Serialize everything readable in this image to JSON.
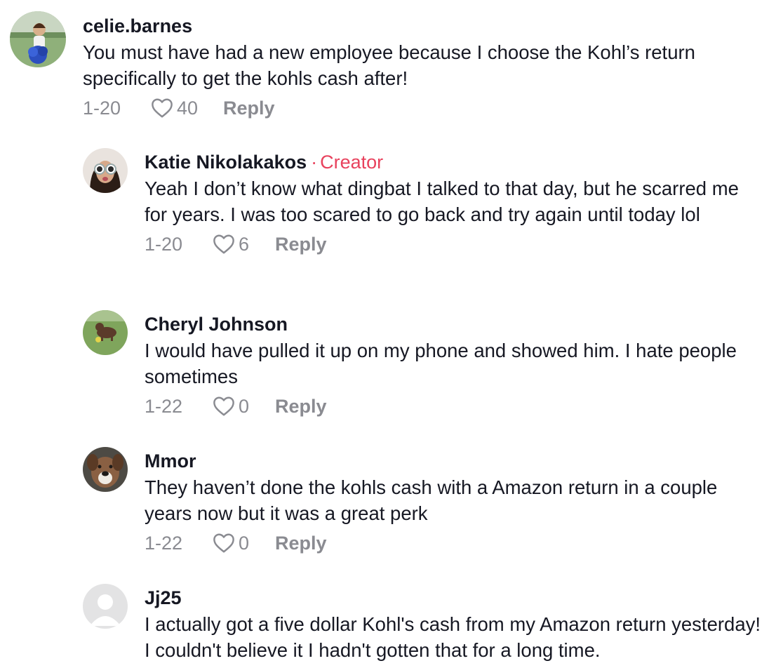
{
  "comments": [
    {
      "username": "celie.barnes",
      "text": "You must have had a new employee because I choose the Kohl’s return specifically to get the kohls cash after!",
      "date": "1-20",
      "likes": "40",
      "reply": "Reply"
    },
    {
      "username": "Katie Nikolakakos",
      "dot": "·",
      "badge": "Creator",
      "text": "Yeah I don’t know what dingbat I talked to that day, but he scarred me for years. I was too scared to go back and try again until today lol",
      "date": "1-20",
      "likes": "6",
      "reply": "Reply"
    },
    {
      "username": "Cheryl Johnson",
      "text": "I would have pulled it up on my phone and showed him. I hate people sometimes",
      "date": "1-22",
      "likes": "0",
      "reply": "Reply"
    },
    {
      "username": "Mmor",
      "text": "They haven’t done the kohls cash with a Amazon return in a couple years now but it was a great perk",
      "date": "1-22",
      "likes": "0",
      "reply": "Reply"
    },
    {
      "username": "Jj25",
      "text": "I actually got a five dollar Kohl's cash from my Amazon return yesterday! I couldn't believe it I hadn't gotten that for a long time."
    }
  ],
  "colors": {
    "text": "#161823",
    "muted": "#8a8b91",
    "creator": "#e8425d"
  },
  "icons": [
    "heart-outline-icon"
  ]
}
